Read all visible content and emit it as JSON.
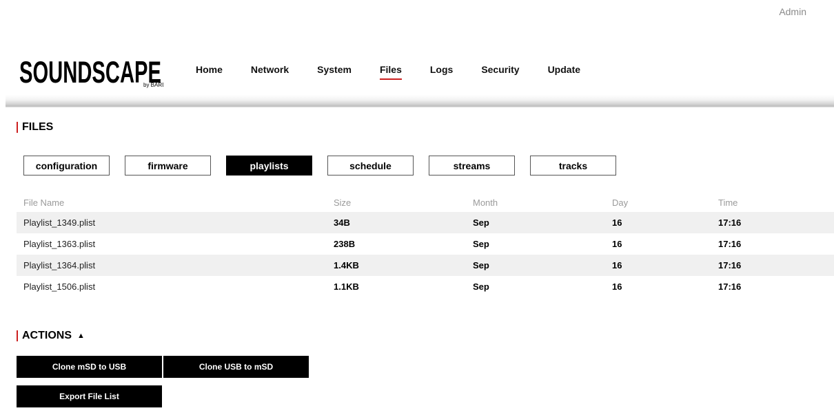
{
  "header": {
    "user": "Admin",
    "logo": {
      "text": "SOUNDSCAPE",
      "subtext": "by BARIX"
    },
    "nav": [
      {
        "label": "Home"
      },
      {
        "label": "Network"
      },
      {
        "label": "System"
      },
      {
        "label": "Files",
        "active": true
      },
      {
        "label": "Logs"
      },
      {
        "label": "Security"
      },
      {
        "label": "Update"
      }
    ]
  },
  "files": {
    "title": "FILES",
    "tabs": [
      {
        "label": "configuration"
      },
      {
        "label": "firmware"
      },
      {
        "label": "playlists",
        "active": true
      },
      {
        "label": "schedule"
      },
      {
        "label": "streams"
      },
      {
        "label": "tracks"
      }
    ],
    "columns": [
      "File Name",
      "Size",
      "Month",
      "Day",
      "Time"
    ],
    "rows": [
      {
        "name": "Playlist_1349.plist",
        "size": "34B",
        "month": "Sep",
        "day": "16",
        "time": "17:16"
      },
      {
        "name": "Playlist_1363.plist",
        "size": "238B",
        "month": "Sep",
        "day": "16",
        "time": "17:16"
      },
      {
        "name": "Playlist_1364.plist",
        "size": "1.4KB",
        "month": "Sep",
        "day": "16",
        "time": "17:16"
      },
      {
        "name": "Playlist_1506.plist",
        "size": "1.1KB",
        "month": "Sep",
        "day": "16",
        "time": "17:16"
      }
    ]
  },
  "actions": {
    "title": "ACTIONS",
    "toggle_glyph": "▲",
    "buttons": {
      "clone_msd_to_usb": "Clone mSD to USB",
      "clone_usb_to_msd": "Clone USB to mSD",
      "export_file_list": "Export File List"
    }
  },
  "colors": {
    "accent": "#cc1f1f",
    "active_tab_bg": "#000000",
    "row_alt_bg": "#f0f0f0"
  }
}
